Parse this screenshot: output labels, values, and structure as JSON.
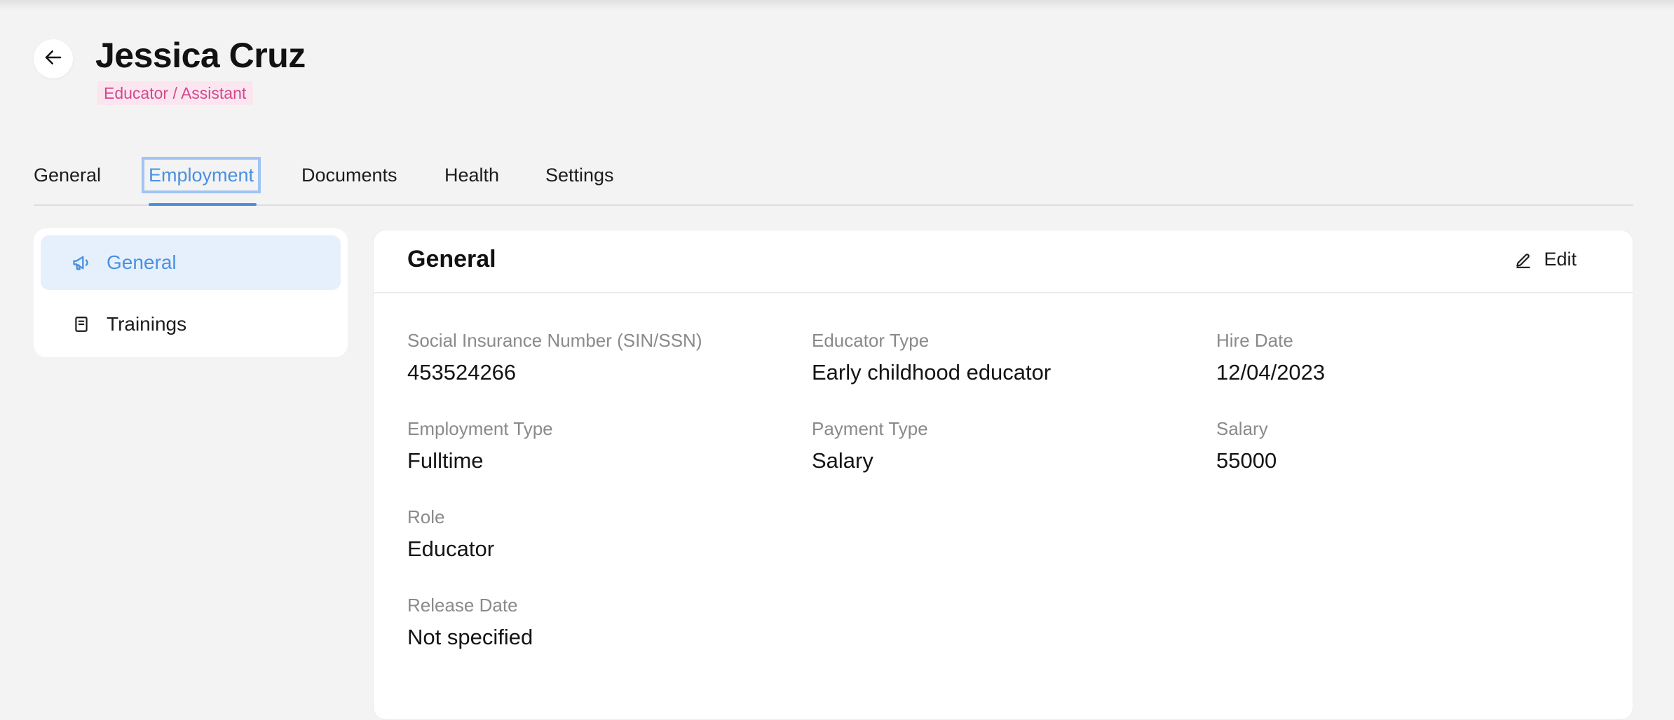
{
  "header": {
    "name": "Jessica Cruz",
    "role": "Educator / Assistant"
  },
  "tabs": [
    {
      "label": "General"
    },
    {
      "label": "Employment"
    },
    {
      "label": "Documents"
    },
    {
      "label": "Health"
    },
    {
      "label": "Settings"
    }
  ],
  "active_tab": "Employment",
  "sidenav": {
    "items": [
      {
        "label": "General",
        "icon": "megaphone-icon"
      },
      {
        "label": "Trainings",
        "icon": "book-icon"
      }
    ]
  },
  "panel": {
    "title": "General",
    "edit_label": "Edit",
    "fields": {
      "sin": {
        "label": "Social Insurance Number (SIN/SSN)",
        "value": "453524266"
      },
      "educator_type": {
        "label": "Educator Type",
        "value": "Early childhood educator"
      },
      "hire_date": {
        "label": "Hire Date",
        "value": "12/04/2023"
      },
      "employment_type": {
        "label": "Employment Type",
        "value": "Fulltime"
      },
      "payment_type": {
        "label": "Payment Type",
        "value": "Salary"
      },
      "salary": {
        "label": "Salary",
        "value": "55000"
      },
      "role": {
        "label": "Role",
        "value": "Educator"
      },
      "release_date": {
        "label": "Release Date",
        "value": "Not specified"
      }
    }
  },
  "colors": {
    "accent": "#4a90e2",
    "badge_text": "#d24a8e",
    "badge_bg": "#fbe6f0",
    "background": "#f3f3f3"
  }
}
